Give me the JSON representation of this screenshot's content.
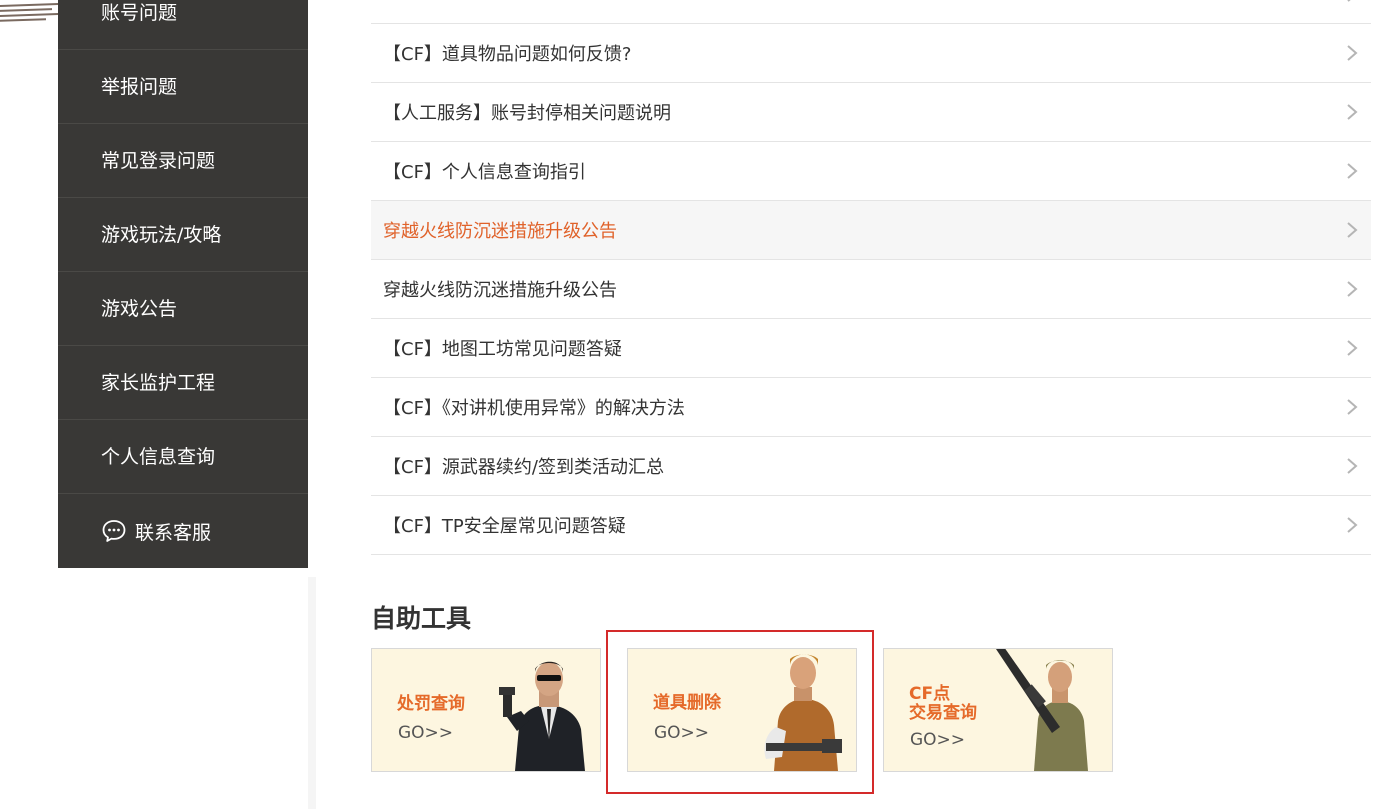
{
  "sidebar": {
    "items": [
      {
        "label": "账号问题"
      },
      {
        "label": "举报问题"
      },
      {
        "label": "常见登录问题"
      },
      {
        "label": "游戏玩法/攻略"
      },
      {
        "label": "游戏公告"
      },
      {
        "label": "家长监护工程"
      },
      {
        "label": "个人信息查询"
      }
    ],
    "contact_label": "联系客服"
  },
  "articles": [
    {
      "title": "【CF】道具物品问题如何反馈?"
    },
    {
      "title": "【人工服务】账号封停相关问题说明"
    },
    {
      "title": "【CF】个人信息查询指引"
    },
    {
      "title": "穿越火线防沉迷措施升级公告"
    },
    {
      "title": "穿越火线防沉迷措施升级公告"
    },
    {
      "title": "【CF】地图工坊常见问题答疑"
    },
    {
      "title": "【CF】《对讲机使用异常》的解决方法"
    },
    {
      "title": "【CF】源武器续约/签到类活动汇总"
    },
    {
      "title": "【CF】TP安全屋常见问题答疑"
    }
  ],
  "tools": {
    "title": "自助工具",
    "items": [
      {
        "name": "处罚查询",
        "go": "GO>>"
      },
      {
        "name": "道具删除",
        "go": "GO>>"
      },
      {
        "name_line1": "CF点",
        "name_line2": "交易查询",
        "go": "GO>>"
      }
    ]
  },
  "colors": {
    "sidebar_bg": "#393836",
    "active_text": "#e0622a",
    "tool_title": "#e56a2a",
    "highlight_border": "#d42a2a"
  }
}
